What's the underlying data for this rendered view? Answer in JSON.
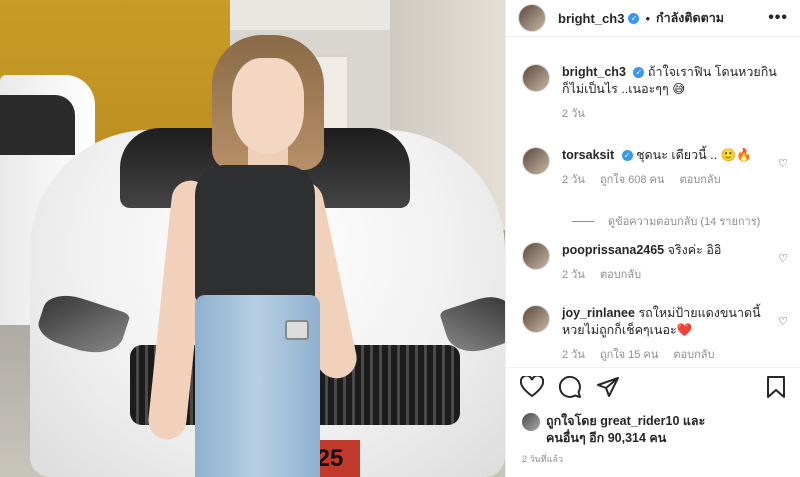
{
  "post": {
    "username": "bright_ch3",
    "follow_state": "กำลังติดตาม",
    "more_label": "•••",
    "plate_text": "25"
  },
  "caption": {
    "username": "bright_ch3",
    "text": "ถ้าใจเราฟิน โดนหวยกินก็ไม่เป็นไร ..เนอะๆๆ 😅",
    "time": "2 วัน"
  },
  "comments": [
    {
      "username": "torsaksit",
      "verified": true,
      "text": "ชุดนะ เดียวนี้ .. 🙂🔥",
      "time": "2 วัน",
      "likes": "ถูกใจ 608 คน",
      "reply": "ตอบกลับ"
    },
    {
      "username": "pooprissana2465",
      "verified": false,
      "text": "จริงค่ะ อิอิ",
      "time": "2 วัน",
      "likes": "",
      "reply": "ตอบกลับ"
    },
    {
      "username": "joy_rinlanee",
      "verified": false,
      "text": "รถใหม่ป้ายแดงขนาดนี้ หวยไม่ถูกก็เช็คๆเนอะ❤️",
      "time": "2 วัน",
      "likes": "ถูกใจ 15 คน",
      "reply": "ตอบกลับ"
    }
  ],
  "view_replies": "ดูข้อความตอบกลับ (14 รายการ)",
  "likes_summary": {
    "line1": "ถูกใจโดย great_rider10 และ",
    "line2": "คนอื่นๆ อีก 90,314 คน"
  },
  "timestamp": "2 วันที่แล้ว",
  "icons": [
    "heart-icon",
    "comment-icon",
    "share-icon",
    "bookmark-icon",
    "more-icon",
    "verified-icon"
  ]
}
